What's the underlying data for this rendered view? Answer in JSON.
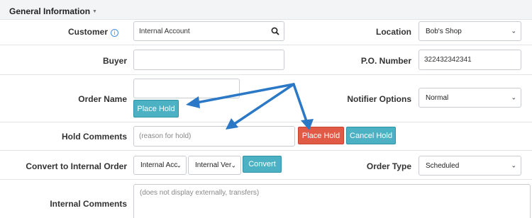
{
  "section": {
    "title": "General Information"
  },
  "customer": {
    "label": "Customer",
    "value": "Internal Account"
  },
  "location": {
    "label": "Location",
    "selected": "Bob's Shop"
  },
  "buyer": {
    "label": "Buyer",
    "value": ""
  },
  "po_number": {
    "label": "P.O. Number",
    "value": "322432342341"
  },
  "order_name": {
    "label": "Order Name",
    "value": "",
    "place_hold_label": "Place Hold"
  },
  "notifier": {
    "label": "Notifier Options",
    "selected": "Normal"
  },
  "hold_comments": {
    "label": "Hold Comments",
    "placeholder": "(reason for hold)",
    "place_hold_label": "Place Hold",
    "cancel_hold_label": "Cancel Hold"
  },
  "convert": {
    "label": "Convert to Internal Order",
    "account_selected": "Internal Acc",
    "vendor_selected": "Internal Ver",
    "button_label": "Convert"
  },
  "order_type": {
    "label": "Order Type",
    "selected": "Scheduled"
  },
  "internal_comments": {
    "label": "Internal Comments",
    "placeholder": "(does not display externally, transfers)"
  },
  "icons": {
    "info": "info-icon",
    "search": "search-icon",
    "dropdown": "chevron-down-icon",
    "caret": "caret-down-icon"
  },
  "colors": {
    "teal_button": "#4bb1c3",
    "red_button": "#e05a46",
    "arrow": "#2a78c6"
  }
}
